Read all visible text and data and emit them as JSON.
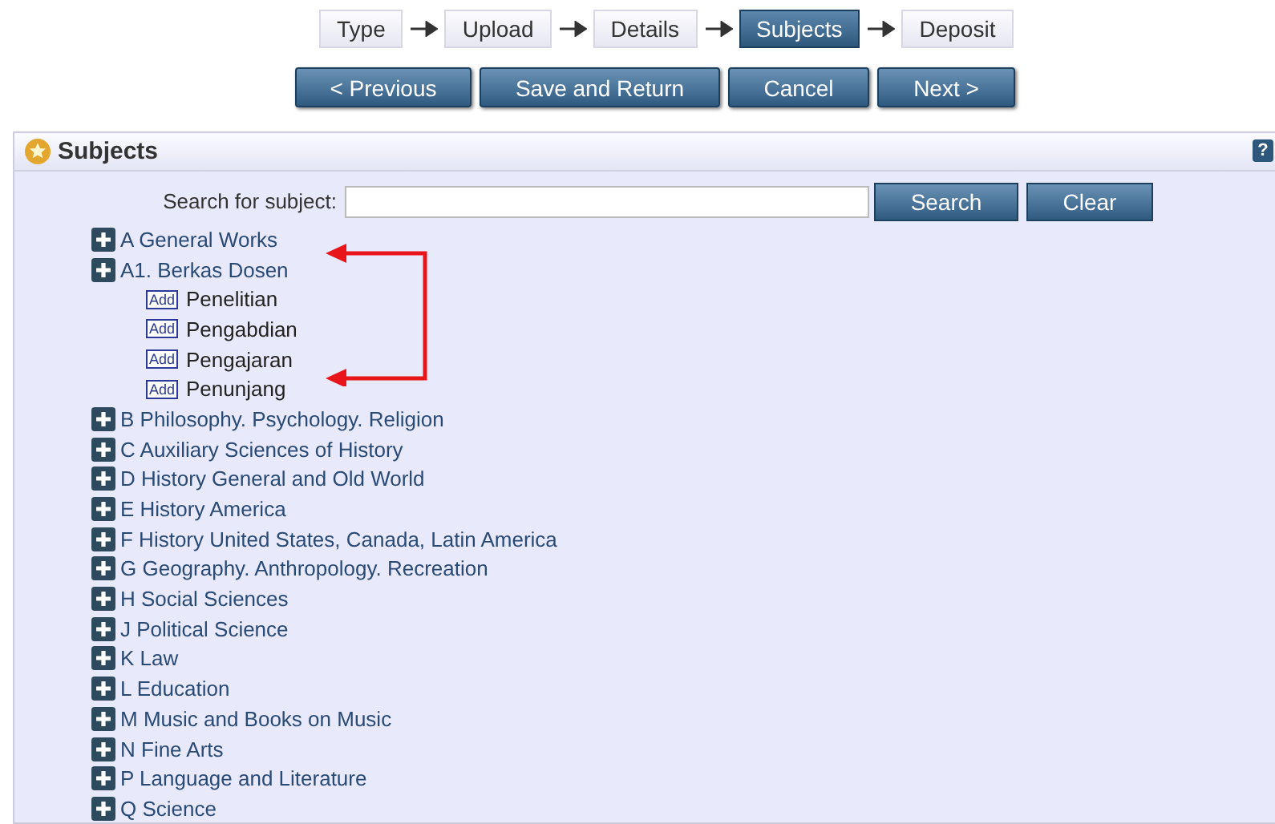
{
  "steps": [
    {
      "label": "Type",
      "selected": false
    },
    {
      "label": "Upload",
      "selected": false
    },
    {
      "label": "Details",
      "selected": false
    },
    {
      "label": "Subjects",
      "selected": true
    },
    {
      "label": "Deposit",
      "selected": false
    }
  ],
  "nav_buttons": [
    "< Previous",
    "Save and Return",
    "Cancel",
    "Next >"
  ],
  "panel": {
    "title": "Subjects",
    "help": "?",
    "search": {
      "label": "Search for subject:",
      "button": "Search",
      "clear": "Clear"
    },
    "tree": [
      {
        "label": "A General Works"
      },
      {
        "label": "A1. Berkas Dosen",
        "children": [
          {
            "label": "Penelitian",
            "action": "Add"
          },
          {
            "label": "Pengabdian",
            "action": "Add"
          },
          {
            "label": "Pengajaran",
            "action": "Add"
          },
          {
            "label": "Penunjang",
            "action": "Add"
          }
        ]
      },
      {
        "label": "B Philosophy. Psychology. Religion"
      },
      {
        "label": "C Auxiliary Sciences of History"
      },
      {
        "label": "D History General and Old World"
      },
      {
        "label": "E History America"
      },
      {
        "label": "F History United States, Canada, Latin America"
      },
      {
        "label": "G Geography. Anthropology. Recreation"
      },
      {
        "label": "H Social Sciences"
      },
      {
        "label": "J Political Science"
      },
      {
        "label": "K Law"
      },
      {
        "label": "L Education"
      },
      {
        "label": "M Music and Books on Music"
      },
      {
        "label": "N Fine Arts"
      },
      {
        "label": "P Language and Literature"
      },
      {
        "label": "Q Science"
      }
    ]
  }
}
